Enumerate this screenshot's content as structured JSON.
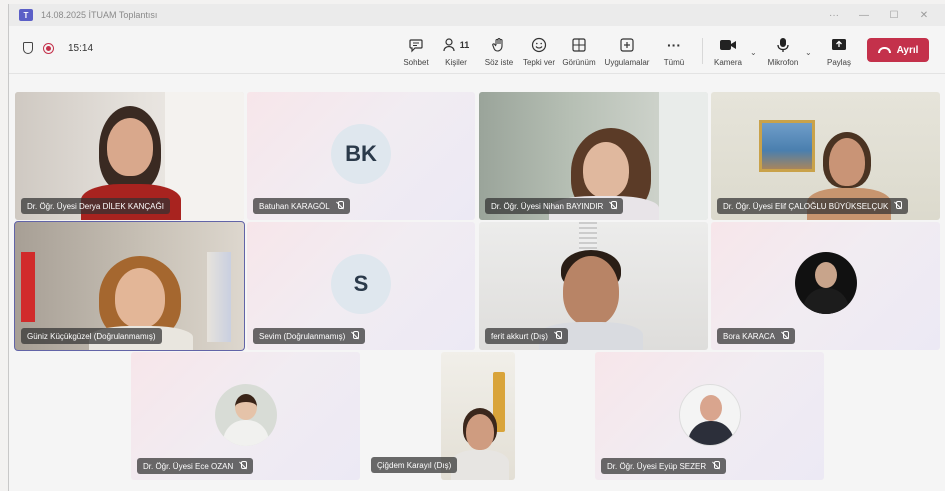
{
  "window": {
    "title": "14.08.2025 İTUAM Toplantısı"
  },
  "toolbar": {
    "timer": "15:14",
    "participant_count": "11",
    "buttons": {
      "chat": "Sohbet",
      "people": "Kişiler",
      "raise": "Söz iste",
      "react": "Tepki ver",
      "view": "Görünüm",
      "apps": "Uygulamalar",
      "more": "Tümü",
      "camera": "Kamera",
      "mic": "Mikrofon",
      "share": "Paylaş",
      "leave": "Ayrıl"
    }
  },
  "participants": [
    {
      "name": "Dr. Öğr. Üyesi Derya DİLEK KANÇAĞI",
      "muted": false,
      "video": true
    },
    {
      "name": "Batuhan KARAGÖL",
      "muted": true,
      "initials": "BK"
    },
    {
      "name": "Dr. Öğr. Üyesi Nihan BAYINDIR",
      "muted": true,
      "video": true
    },
    {
      "name": "Dr. Öğr. Üyesi Elif ÇALOĞLU BÜYÜKSELÇUK",
      "muted": true,
      "video": true
    },
    {
      "name": "Güniz Küçükgüzel (Doğrulanmamış)",
      "muted": false,
      "video": true
    },
    {
      "name": "Sevim (Doğrulanmamış)",
      "muted": true,
      "initials": "S"
    },
    {
      "name": "ferit akkurt (Dış)",
      "muted": true,
      "video": true
    },
    {
      "name": "Bora KARACA",
      "muted": true,
      "avatar": true
    },
    {
      "name": "Dr. Öğr. Üyesi Ece OZAN",
      "muted": true,
      "avatar": true
    },
    {
      "name": "Çiğdem Karayıl (Dış)",
      "muted": false,
      "video": true
    },
    {
      "name": "Dr. Öğr. Üyesi Eyüp SEZER",
      "muted": true,
      "avatar": true
    }
  ],
  "colors": {
    "accent": "#6264a7",
    "leave": "#c4314b"
  }
}
